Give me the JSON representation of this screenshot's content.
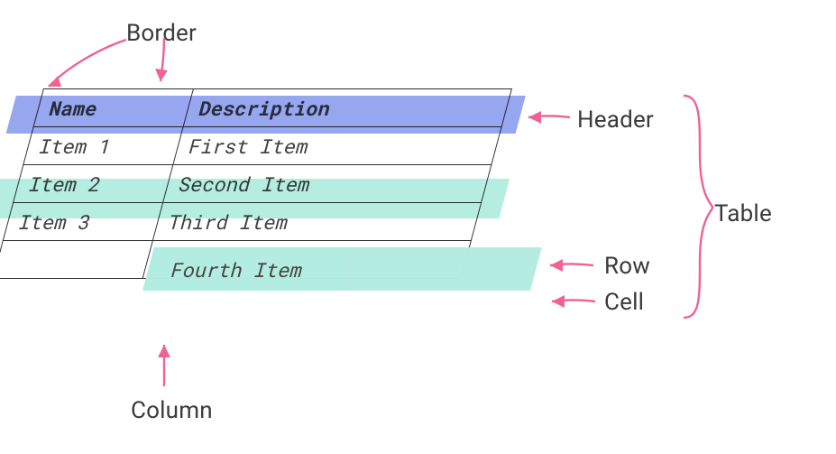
{
  "labels": {
    "border": "Border",
    "header": "Header",
    "table": "Table",
    "row": "Row",
    "cell": "Cell",
    "column": "Column"
  },
  "table": {
    "headers": {
      "name": "Name",
      "description": "Description"
    },
    "rows": [
      {
        "name": "Item 1",
        "description": "First Item"
      },
      {
        "name": "Item 2",
        "description": "Second Item"
      },
      {
        "name": "Item 3",
        "description": "Third Item"
      },
      {
        "name": "",
        "description": ""
      }
    ]
  },
  "floating_cell": {
    "text": "Fourth Item"
  },
  "colors": {
    "header_highlight": "#8c9eee",
    "row_highlight": "#b2ece0",
    "arrow": "#f06292",
    "text": "#424242"
  }
}
